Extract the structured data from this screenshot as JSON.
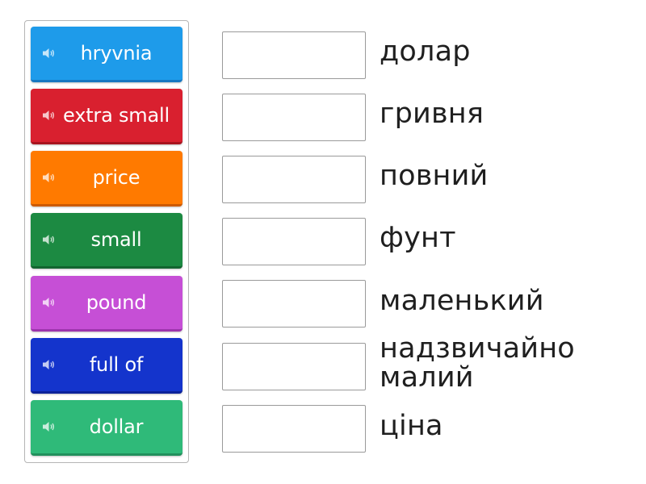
{
  "tiles": [
    {
      "label": "hryvnia",
      "color": "#1e9bea",
      "edge": "#1778c2",
      "icon": "speaker-icon"
    },
    {
      "label": "extra small",
      "color": "#d9202f",
      "edge": "#a8141f",
      "icon": "speaker-icon"
    },
    {
      "label": "price",
      "color": "#ff7a00",
      "edge": "#cc5a00",
      "icon": "speaker-icon"
    },
    {
      "label": "small",
      "color": "#1c8a42",
      "edge": "#136530",
      "icon": "speaker-icon"
    },
    {
      "label": "pound",
      "color": "#c64fd6",
      "edge": "#9d35ad",
      "icon": "speaker-icon"
    },
    {
      "label": "full of",
      "color": "#1434cc",
      "edge": "#0c2299",
      "icon": "speaker-icon"
    },
    {
      "label": "dollar",
      "color": "#2fba79",
      "edge": "#22905c",
      "icon": "speaker-icon"
    }
  ],
  "targets": [
    {
      "label": "долар"
    },
    {
      "label": "гривня"
    },
    {
      "label": "повний"
    },
    {
      "label": "фунт"
    },
    {
      "label": "маленький"
    },
    {
      "label": "надзвичайно малий"
    },
    {
      "label": "ціна"
    }
  ]
}
